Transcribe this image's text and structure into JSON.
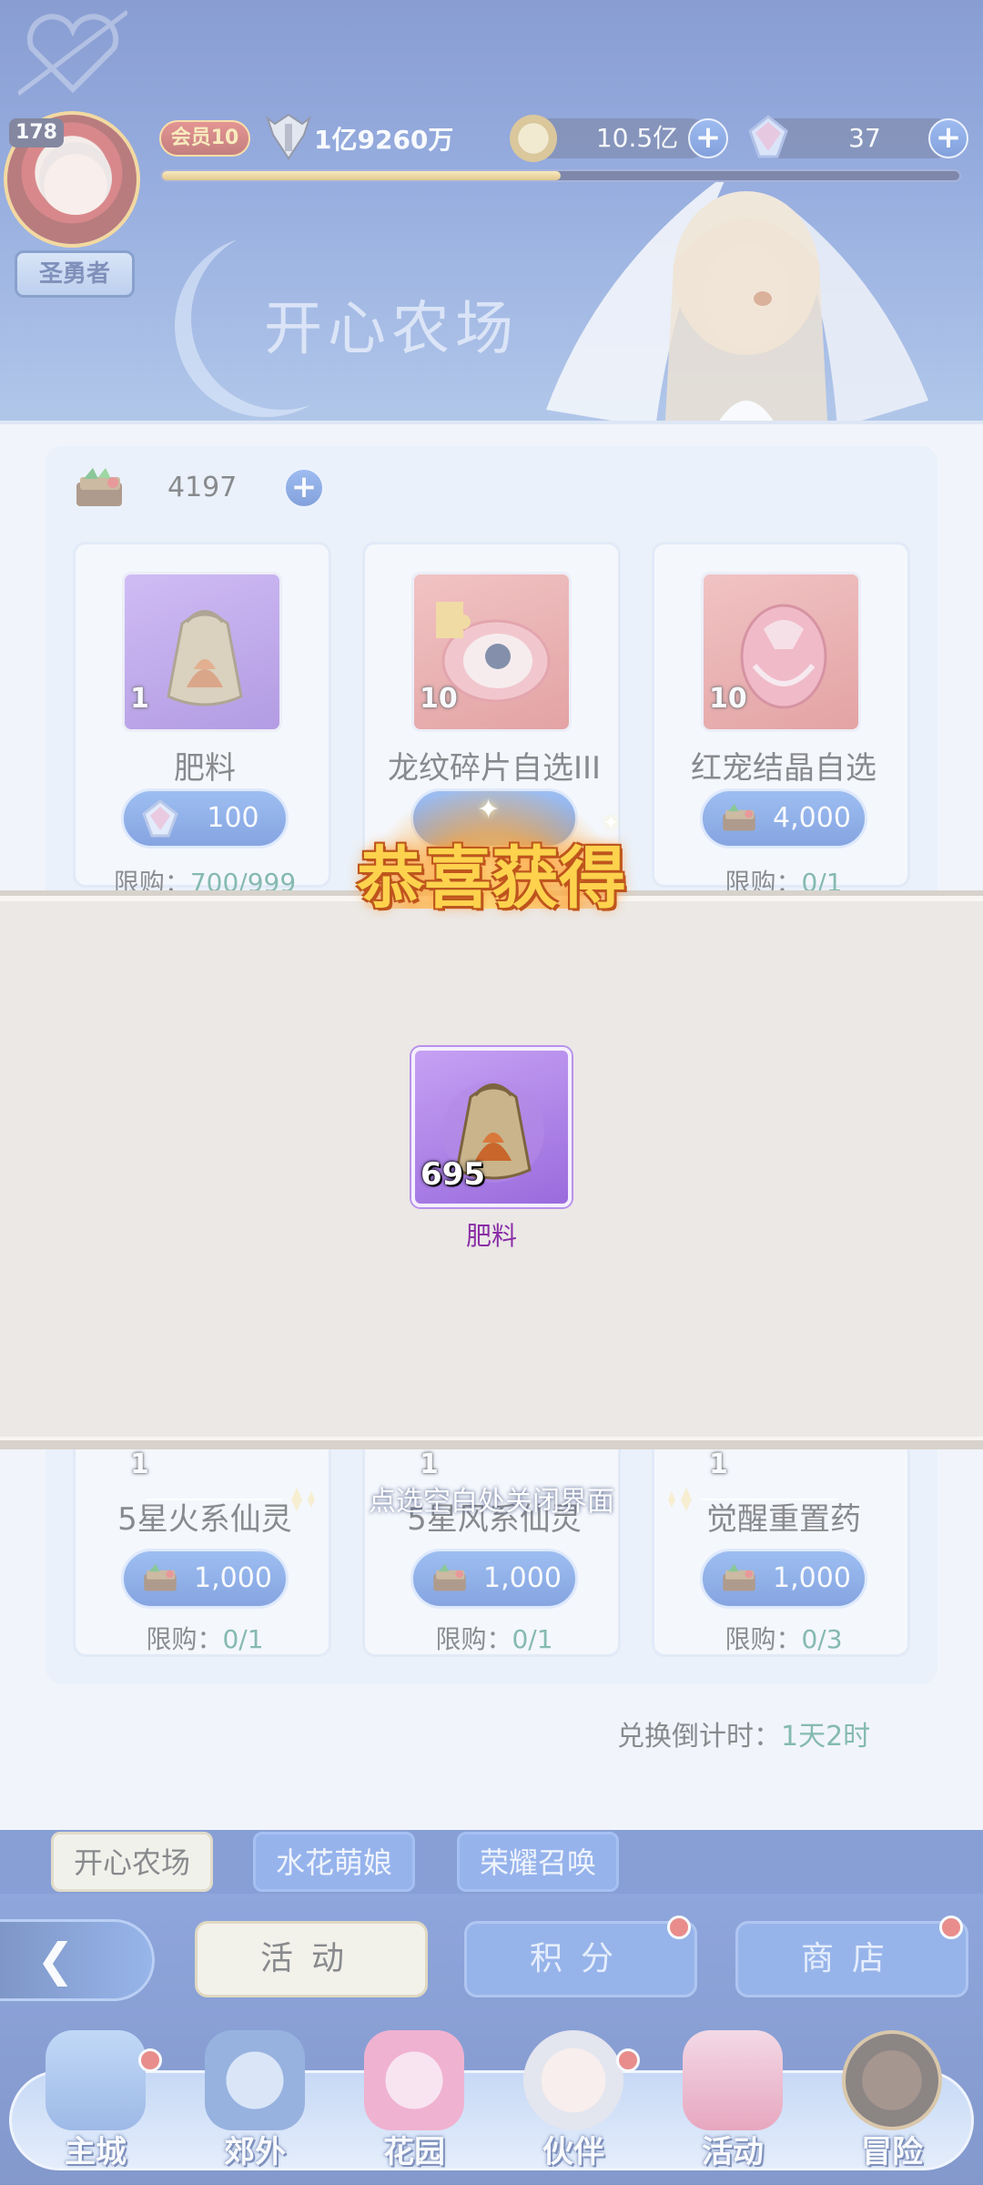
{
  "header": {
    "level": "178",
    "rank": "圣勇者",
    "vip": "会员10",
    "power": "1亿9260万",
    "gold": "10.5亿",
    "gems": "37",
    "exp_fraction": 0.5
  },
  "shop": {
    "title": "开心农场",
    "currency_count": "4197",
    "countdown_label": "兑换倒计时：",
    "countdown_value": "1天2时",
    "items": [
      {
        "name": "肥料",
        "qty": "1",
        "price": "100",
        "limit_label": "限购：",
        "limit_value": "700/999",
        "currency": "gem-icon"
      },
      {
        "name": "龙纹碎片自选III",
        "qty": "10",
        "price": "",
        "limit_label": "",
        "limit_value": "",
        "currency": "gem-icon"
      },
      {
        "name": "红宠结晶自选",
        "qty": "10",
        "price": "4,000",
        "limit_label": "限购：",
        "limit_value": "0/1",
        "currency": "book-icon"
      },
      {
        "name": "5星火系仙灵",
        "qty": "1",
        "price": "1,000",
        "limit_label": "限购：",
        "limit_value": "0/1",
        "currency": "book-icon"
      },
      {
        "name": "5星风系仙灵",
        "qty": "1",
        "price": "1,000",
        "limit_label": "限购：",
        "limit_value": "0/1",
        "currency": "book-icon"
      },
      {
        "name": "觉醒重置药",
        "qty": "1",
        "price": "1,000",
        "limit_label": "限购：",
        "limit_value": "0/3",
        "currency": "book-icon"
      }
    ]
  },
  "tabs": [
    "开心农场",
    "水花萌娘",
    "荣耀召唤"
  ],
  "actions": {
    "activity": "活动",
    "points": "积分",
    "store": "商店"
  },
  "nav": [
    "主城",
    "郊外",
    "花园",
    "伙伴",
    "活动",
    "冒险"
  ],
  "popup": {
    "title": "恭喜获得",
    "reward_qty": "695",
    "reward_name": "肥料",
    "close_hint": "点选空白处关闭界面"
  },
  "colors": {
    "accent": "#2f63cc",
    "limit_value": "#2f8a73",
    "reward_name": "#8a2ea6",
    "title_gold": "#ffd24d"
  }
}
